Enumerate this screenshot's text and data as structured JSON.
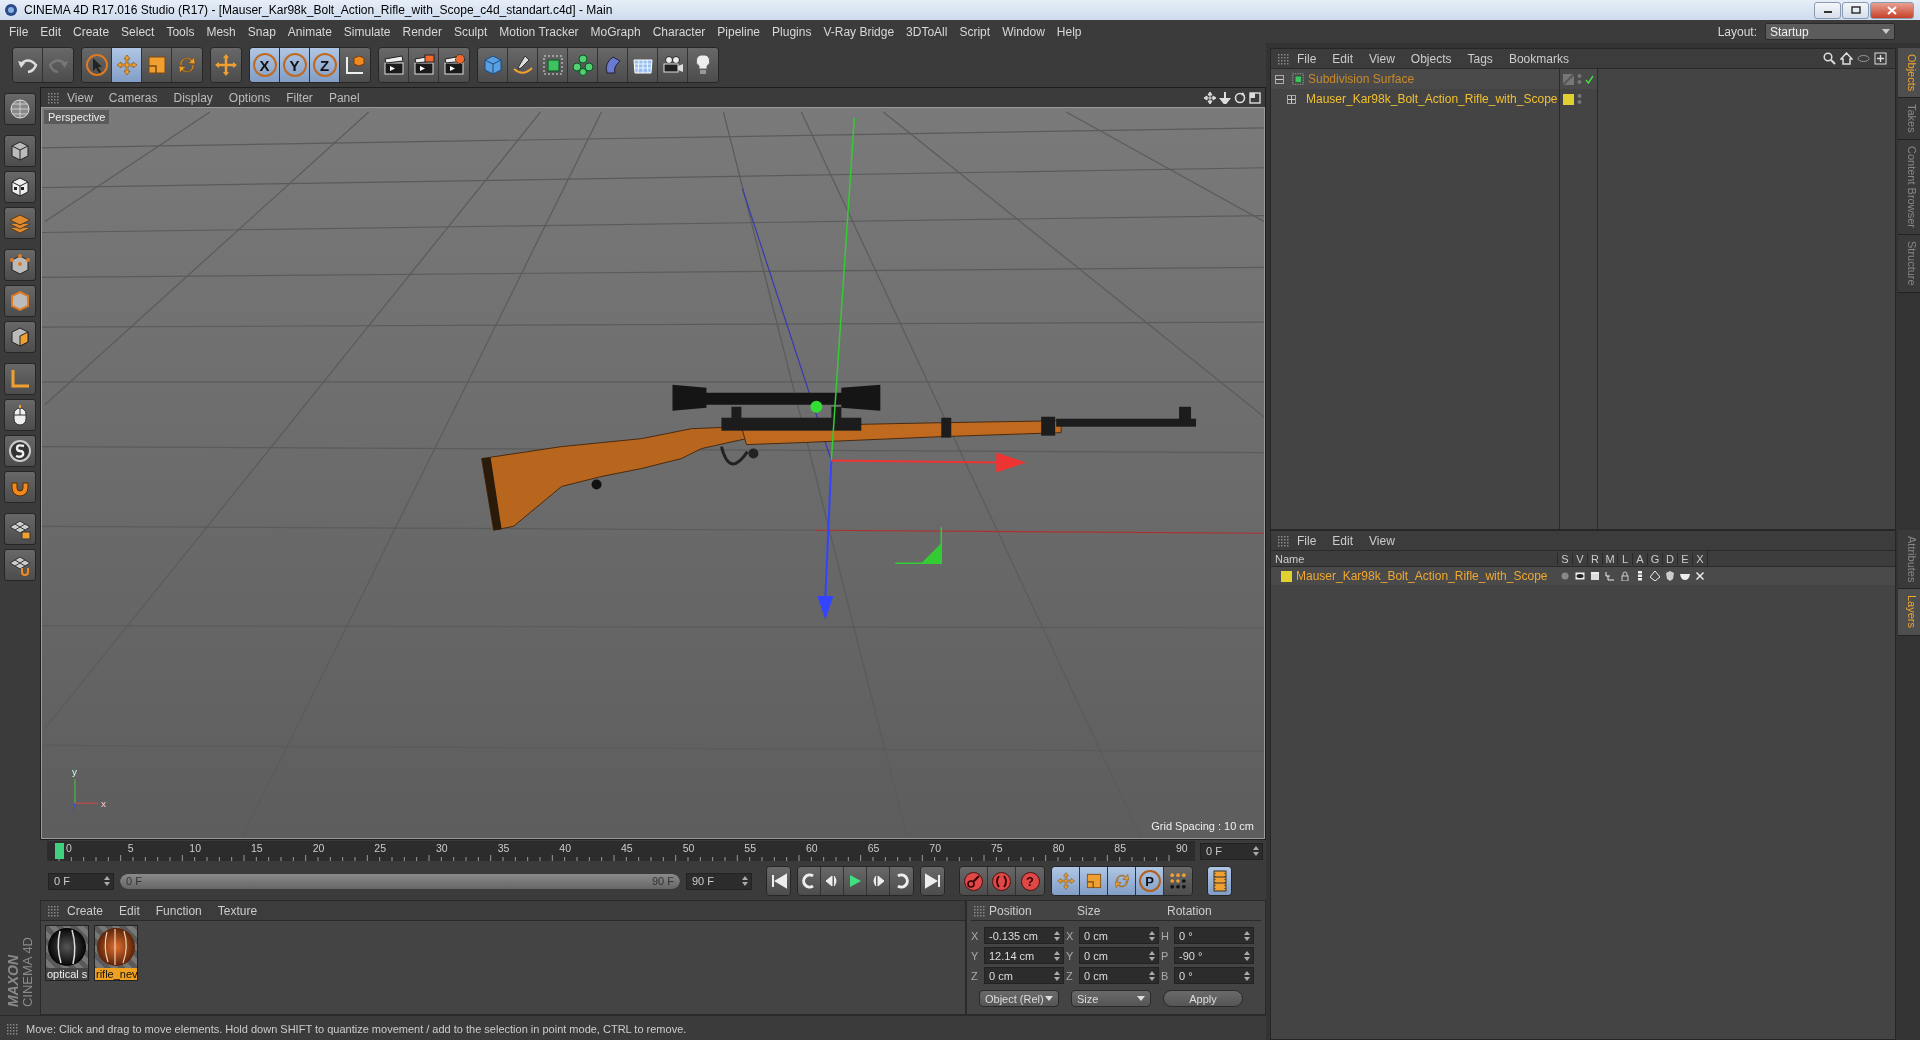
{
  "window": {
    "title": "CINEMA 4D R17.016 Studio (R17) - [Mauser_Kar98k_Bolt_Action_Rifle_with_Scope_c4d_standart.c4d] - Main"
  },
  "menu": [
    "File",
    "Edit",
    "Create",
    "Select",
    "Tools",
    "Mesh",
    "Snap",
    "Animate",
    "Simulate",
    "Render",
    "Sculpt",
    "Motion Tracker",
    "MoGraph",
    "Character",
    "Pipeline",
    "Plugins",
    "V-Ray Bridge",
    "3DToAll",
    "Script",
    "Window",
    "Help"
  ],
  "layout": {
    "label": "Layout:",
    "value": "Startup"
  },
  "toolbar": [
    [
      {
        "kind": "undo",
        "selected": false,
        "disabled": false
      },
      {
        "kind": "redo",
        "selected": false,
        "disabled": true
      }
    ],
    [
      {
        "kind": "select",
        "selected": false,
        "disabled": false
      },
      {
        "kind": "move",
        "selected": true,
        "disabled": false
      },
      {
        "kind": "scale",
        "selected": false,
        "disabled": false
      },
      {
        "kind": "rotate",
        "selected": false,
        "disabled": false
      }
    ],
    [
      {
        "kind": "plus",
        "selected": false,
        "disabled": false
      }
    ],
    [
      {
        "kind": "axis",
        "label": "X",
        "selected": true,
        "disabled": false
      },
      {
        "kind": "axis",
        "label": "Y",
        "selected": true,
        "disabled": false
      },
      {
        "kind": "axis",
        "label": "Z",
        "selected": true,
        "disabled": false
      },
      {
        "kind": "coord",
        "selected": false,
        "disabled": false
      }
    ],
    [
      {
        "kind": "render-view",
        "selected": false,
        "disabled": false
      },
      {
        "kind": "render-picture",
        "selected": false,
        "disabled": false
      },
      {
        "kind": "render-settings",
        "selected": false,
        "disabled": false
      }
    ],
    [
      {
        "kind": "cube",
        "selected": false,
        "disabled": false
      },
      {
        "kind": "pen",
        "selected": false,
        "disabled": false
      },
      {
        "kind": "subdiv",
        "selected": false,
        "disabled": false
      },
      {
        "kind": "cloner",
        "selected": false,
        "disabled": false
      },
      {
        "kind": "deformer",
        "selected": false,
        "disabled": false
      },
      {
        "kind": "floor",
        "selected": false,
        "disabled": false
      },
      {
        "kind": "camera",
        "selected": false,
        "disabled": false
      },
      {
        "kind": "light",
        "selected": false,
        "disabled": false
      }
    ]
  ],
  "viewport": {
    "menu": [
      "View",
      "Cameras",
      "Display",
      "Options",
      "Filter",
      "Panel"
    ],
    "camera": "Perspective",
    "grid_spacing": "Grid Spacing : 10 cm",
    "axis_labels": [
      "y",
      "x"
    ]
  },
  "timeline": {
    "ticks": [
      "0",
      "5",
      "10",
      "15",
      "20",
      "25",
      "30",
      "35",
      "40",
      "45",
      "50",
      "55",
      "60",
      "65",
      "70",
      "75",
      "80",
      "85",
      "90"
    ],
    "playhead": {
      "level": 0
    },
    "range": {
      "level": 1
    },
    "current_frame": "0 F",
    "start": "0 F",
    "range_start": "0 F",
    "range_end": "90 F",
    "end": "90 F",
    "record_tools": [
      {
        "kind": "record"
      },
      {
        "kind": "autokey"
      },
      {
        "kind": "keyset",
        "label": "?"
      }
    ],
    "key_tools": [
      {
        "kind": "move",
        "selected": true
      },
      {
        "kind": "scale",
        "selected": true
      },
      {
        "kind": "rotate",
        "selected": true
      },
      {
        "kind": "param",
        "label": "P",
        "selected": true
      },
      {
        "kind": "dots",
        "selected": false
      }
    ],
    "film": {
      "selected": true
    }
  },
  "materials": {
    "menu": [
      "Create",
      "Edit",
      "Function",
      "Texture"
    ],
    "items": [
      {
        "name": "optical s",
        "kind": "dark",
        "selected": false
      },
      {
        "name": "rifle_nev",
        "kind": "wood",
        "selected": true
      }
    ]
  },
  "coordinates": {
    "headers": [
      "Position",
      "Size",
      "Rotation"
    ],
    "rows": [
      {
        "axes": [
          "X",
          "X",
          "H"
        ],
        "values": [
          "-0.135 cm",
          "0 cm",
          "0 °"
        ]
      },
      {
        "axes": [
          "Y",
          "Y",
          "P"
        ],
        "values": [
          "12.14 cm",
          "0 cm",
          "-90 °"
        ]
      },
      {
        "axes": [
          "Z",
          "Z",
          "B"
        ],
        "values": [
          "0 cm",
          "0 cm",
          "0 °"
        ]
      }
    ],
    "mode": "Object (Rel)",
    "size_mode": "Size",
    "apply": "Apply"
  },
  "logo": {
    "brand": "MAXON",
    "product": "CINEMA 4D"
  },
  "status_bar": "Move: Click and drag to move elements. Hold down SHIFT to quantize movement / add to the selection in point mode, CTRL to remove.",
  "objects": {
    "menu": [
      "File",
      "Edit",
      "View",
      "Objects",
      "Tags",
      "Bookmarks"
    ],
    "tree": [
      {
        "name": "Subdivision Surface",
        "kind": "subdivision",
        "expanded": true,
        "enabled": true,
        "children": [
          {
            "name": "Mauser_Kar98k_Bolt_Action_Rifle_with_Scope",
            "kind": "null",
            "expanded": false,
            "color": "#e0d030"
          }
        ]
      }
    ]
  },
  "layers": {
    "menu": [
      "File",
      "Edit",
      "View"
    ],
    "columns": [
      "Name",
      "S",
      "V",
      "R",
      "M",
      "L",
      "A",
      "G",
      "D",
      "E",
      "X"
    ],
    "rows": [
      {
        "name": "Mauser_Kar98k_Bolt_Action_Rifle_with_Scope",
        "color": "#e0d030"
      }
    ]
  },
  "side_tabs": {
    "top": [
      {
        "label": "Objects",
        "selected": true
      },
      {
        "label": "Takes",
        "selected": false
      },
      {
        "label": "Content Browser",
        "selected": false
      },
      {
        "label": "Structure",
        "selected": false
      }
    ],
    "bottom": [
      {
        "label": "Attributes",
        "selected": false
      },
      {
        "label": "Layers",
        "selected": true
      }
    ]
  }
}
